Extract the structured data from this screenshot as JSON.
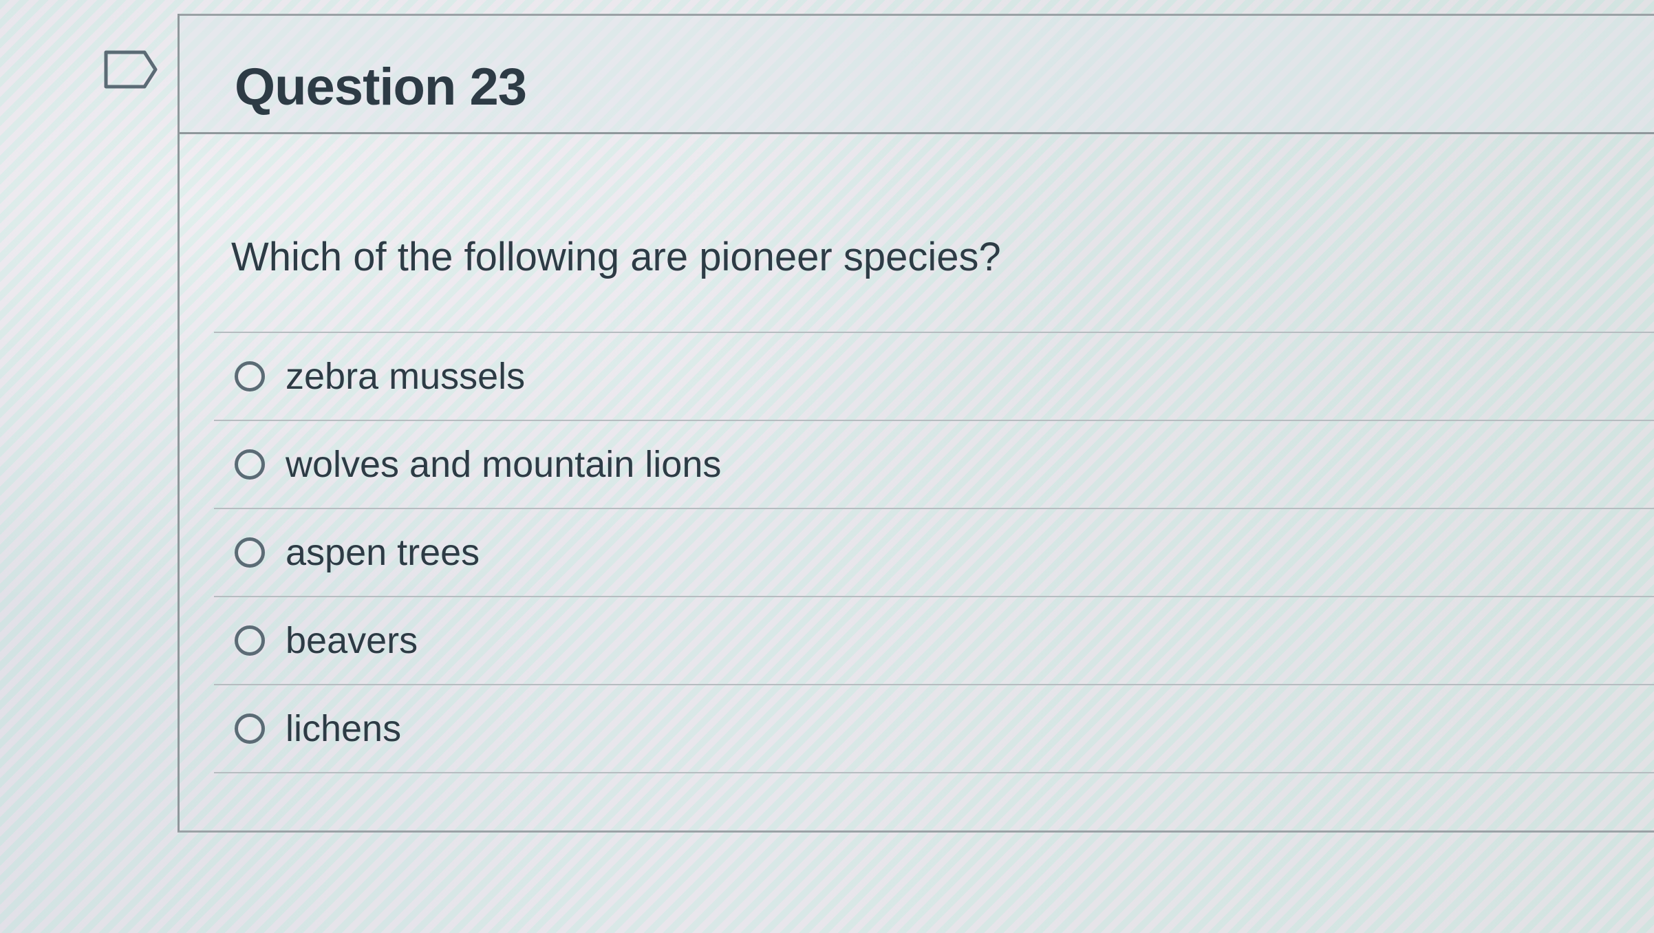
{
  "question": {
    "title": "Question 23",
    "text": "Which of the following are pioneer species?",
    "answers": [
      {
        "label": "zebra mussels",
        "selected": false
      },
      {
        "label": "wolves and mountain lions",
        "selected": false
      },
      {
        "label": "aspen trees",
        "selected": false
      },
      {
        "label": "beavers",
        "selected": false
      },
      {
        "label": "lichens",
        "selected": false
      }
    ]
  },
  "icons": {
    "flag": "flag-question-icon"
  },
  "colors": {
    "text": "#2d3b45",
    "border": "#9aa1a5",
    "radio": "#5b6b75"
  }
}
